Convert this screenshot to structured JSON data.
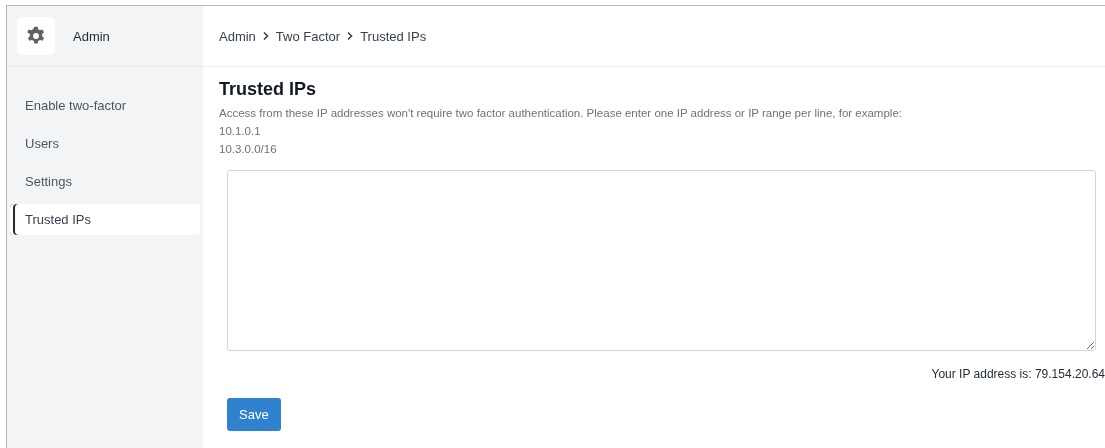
{
  "sidebar": {
    "title": "Admin",
    "items": [
      {
        "label": "Enable two-factor",
        "selected": false
      },
      {
        "label": "Users",
        "selected": false
      },
      {
        "label": "Settings",
        "selected": false
      },
      {
        "label": "Trusted IPs",
        "selected": true
      }
    ]
  },
  "breadcrumb": [
    "Admin",
    "Two Factor",
    "Trusted IPs"
  ],
  "page": {
    "title": "Trusted IPs",
    "description": "Access from these IP addresses won't require two factor authentication. Please enter one IP address or IP range per line, for example:",
    "examples": [
      "10.1.0.1",
      "10.3.0.0/16"
    ],
    "ip_note": "Your IP address is: 79.154.20.64",
    "save_button": "Save"
  }
}
